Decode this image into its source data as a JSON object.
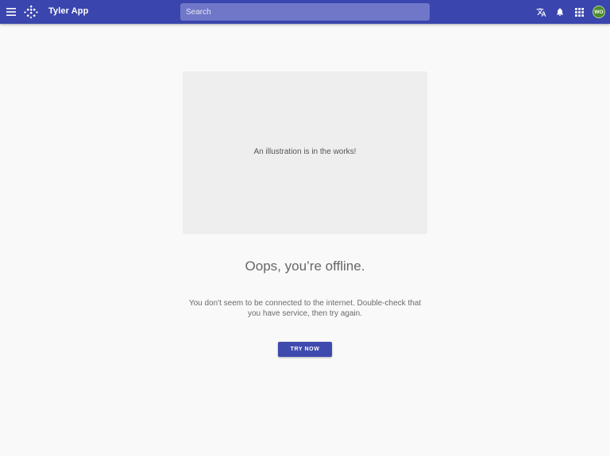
{
  "appbar": {
    "title": "Tyler App",
    "menu_icon": "menu-icon",
    "logo_icon": "tyler-logo-icon",
    "search": {
      "placeholder": "Search",
      "value": ""
    },
    "actions": [
      {
        "icon": "translate-icon"
      },
      {
        "icon": "bell-icon"
      },
      {
        "icon": "apps-grid-icon"
      }
    ],
    "avatar_initials": "WO"
  },
  "content": {
    "illustration_text": "An illustration is in the works!",
    "headline": "Oops, you’re offline.",
    "message": "You don't seem to be connected to the internet. Double-check that you have service, then try again.",
    "button_label": "TRY NOW"
  },
  "colors": {
    "appbar": "#3a45ad",
    "search_bg": "#7077c8",
    "button": "#3f4aaf",
    "avatar": "#4a8c2a",
    "page_bg": "#f9f9f9"
  }
}
